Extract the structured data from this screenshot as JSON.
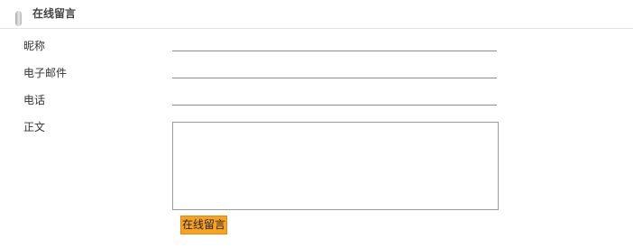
{
  "header": {
    "title": "在线留言"
  },
  "form": {
    "fields": [
      {
        "label": "昵称",
        "value": ""
      },
      {
        "label": "电子邮件",
        "value": ""
      },
      {
        "label": "电话",
        "value": ""
      },
      {
        "label": "正文",
        "value": ""
      }
    ],
    "submit_label": "在线留言"
  },
  "colors": {
    "submit_button": "#f7a321",
    "input_border": "#8c8c8c"
  }
}
